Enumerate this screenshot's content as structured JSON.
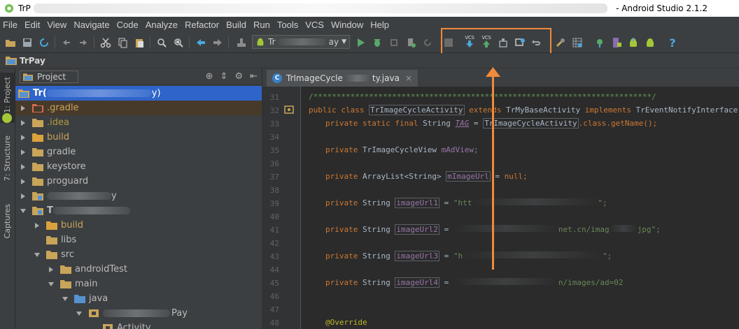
{
  "window": {
    "title_left": "TrP",
    "title_right": "- Android Studio 2.1.2"
  },
  "menu": [
    "File",
    "Edit",
    "View",
    "Navigate",
    "Code",
    "Analyze",
    "Refactor",
    "Build",
    "Run",
    "Tools",
    "VCS",
    "Window",
    "Help"
  ],
  "toolbar": {
    "run_config_label": "Tr",
    "run_config_tail": "ay",
    "vcs_update_label": "VCS",
    "vcs_commit_label": "VCS",
    "help_label": "?",
    "accent": "#f08a3c"
  },
  "navbar": {
    "project": "TrPay"
  },
  "left_strip": {
    "tabs": [
      "1: Project",
      "7: Structure",
      "Captures"
    ]
  },
  "project_panel": {
    "view_mode": "Project",
    "tree": [
      {
        "label": "Tr(",
        "tail": "y)",
        "kind": "root",
        "state": "open",
        "selected": true
      },
      {
        "label": ".gradle",
        "kind": "folder-orange",
        "state": "closed"
      },
      {
        "label": ".idea",
        "kind": "folder",
        "state": "closed",
        "color": "#a58a3a"
      },
      {
        "label": "build",
        "kind": "folder-orange",
        "state": "closed"
      },
      {
        "label": "gradle",
        "kind": "folder",
        "state": "closed"
      },
      {
        "label": "keystore",
        "kind": "folder",
        "state": "closed"
      },
      {
        "label": "proguard",
        "kind": "folder",
        "state": "closed"
      },
      {
        "label": "",
        "tail": "y",
        "kind": "module",
        "state": "closed"
      },
      {
        "label": "T",
        "kind": "module",
        "state": "open"
      },
      {
        "label": "build",
        "kind": "folder-orange",
        "state": "closed"
      },
      {
        "label": "libs",
        "kind": "folder",
        "state": "none"
      },
      {
        "label": "src",
        "kind": "folder",
        "state": "open"
      },
      {
        "label": "androidTest",
        "kind": "folder",
        "state": "closed"
      },
      {
        "label": "main",
        "kind": "folder",
        "state": "open"
      },
      {
        "label": "java",
        "kind": "folder-blue",
        "state": "open"
      },
      {
        "label": "",
        "tail": "Pay",
        "kind": "package",
        "state": "open"
      },
      {
        "label": "Activity",
        "kind": "folder",
        "state": "none"
      }
    ]
  },
  "editor": {
    "tab_label": "TrImageCycle",
    "tab_tail": "ty.java",
    "lines": [
      {
        "no": "31"
      },
      {
        "no": "32"
      },
      {
        "no": "33"
      },
      {
        "no": "34"
      },
      {
        "no": "35"
      },
      {
        "no": "36"
      },
      {
        "no": "37"
      },
      {
        "no": "38"
      },
      {
        "no": "39"
      },
      {
        "no": "40"
      },
      {
        "no": "41"
      },
      {
        "no": "42"
      },
      {
        "no": "43"
      },
      {
        "no": "44"
      },
      {
        "no": "45"
      },
      {
        "no": "46"
      },
      {
        "no": "47"
      },
      {
        "no": "48"
      }
    ],
    "code": {
      "l31": "/*************************************************************************/",
      "l32_kw1": "public class ",
      "l32_cls": "TrImageCycleActivity",
      "l32_kw2": " extends ",
      "l32_base": "TrMyBaseActivity",
      "l32_kw3": " implements ",
      "l32_iface": "TrEventNotifyInterface {",
      "l33_kw": "private static final ",
      "l33_type": "String ",
      "l33_fld": "TAG",
      "l33_eq": " = ",
      "l33_ref": "TrImageCycleActivity",
      "l33_tail": ".class.getName();",
      "l35_kw": "private ",
      "l35_type": "TrImageCycleView ",
      "l35_fld": "mAdView;",
      "l37_kw": "private ",
      "l37_type": "ArrayList<String> ",
      "l37_fld": "mImageUrl",
      "l37_eq": " = ",
      "l37_null": "null;",
      "l39_kw": "private ",
      "l39_type": "String ",
      "l39_fld": "imageUrl1",
      "l39_eq": " = ",
      "l39_str": "\"htt",
      "l39_tail": "\";",
      "l41_kw": "private ",
      "l41_type": "String ",
      "l41_fld": "imageUrl2",
      "l41_eq": " = ",
      "l41_str": "net.cn/imag",
      "l41_tail": "jpg\";",
      "l43_kw": "private ",
      "l43_type": "String ",
      "l43_fld": "imageUrl3",
      "l43_eq": " = ",
      "l43_str": "\"h",
      "l43_tail": "\";",
      "l45_kw": "private ",
      "l45_type": "String ",
      "l45_fld": "imageUrl4",
      "l45_eq": " = ",
      "l45_str": "n/images/ad=02",
      "l48_ann": "@Override"
    }
  }
}
